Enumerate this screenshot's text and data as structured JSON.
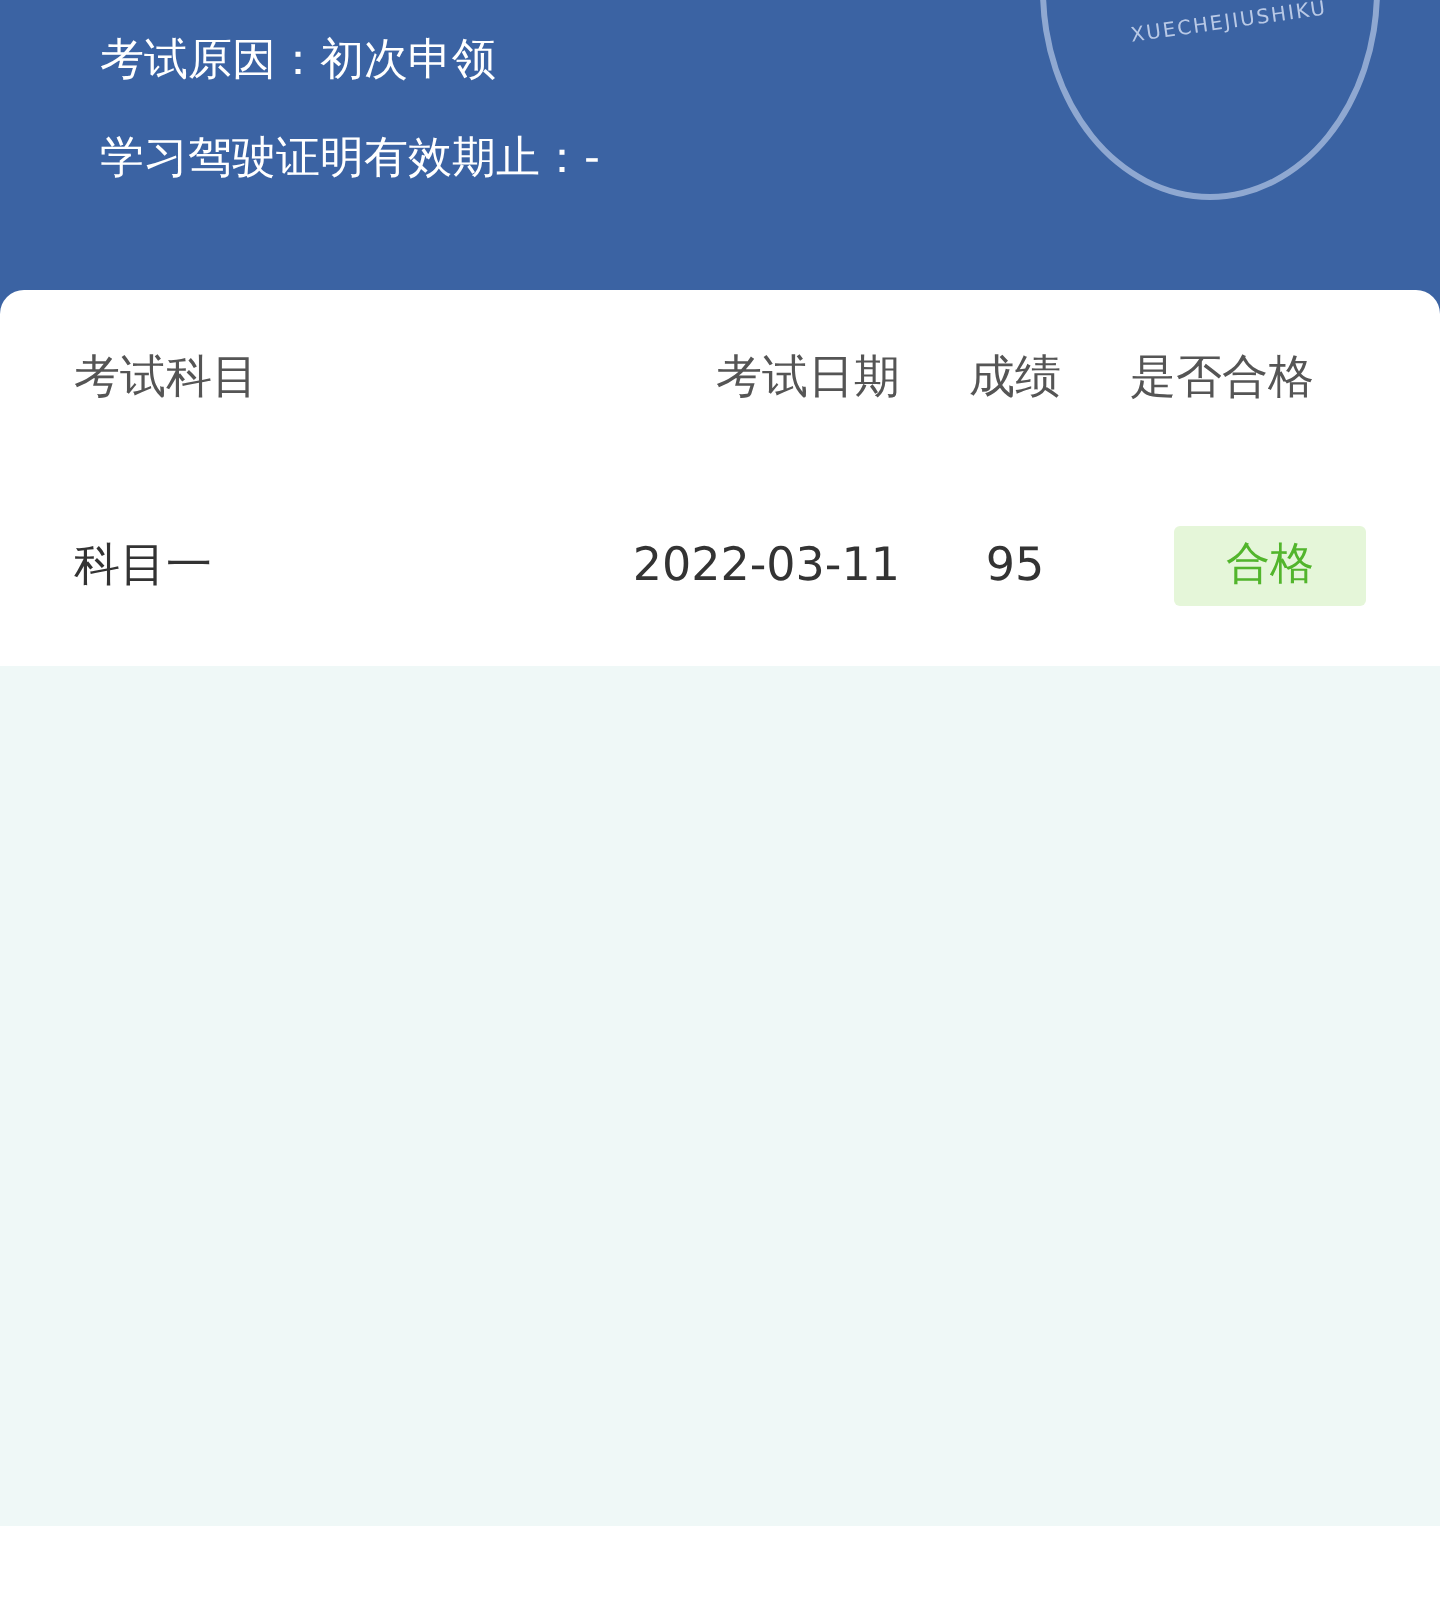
{
  "header": {
    "lines": [
      {
        "label": "考试原因：",
        "value": "初次申领"
      },
      {
        "label": "学习驾驶证明有效期止：",
        "value": "-"
      }
    ],
    "seal_text": "XUECHEJIUSHIKU"
  },
  "table": {
    "columns": [
      "考试科目",
      "考试日期",
      "成绩",
      "是否合格"
    ],
    "rows": [
      {
        "subject": "科目一",
        "date": "2022-03-11",
        "score": "95",
        "result": "合格",
        "passed": true
      }
    ]
  }
}
